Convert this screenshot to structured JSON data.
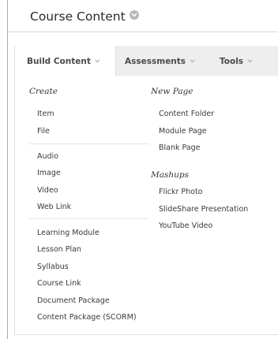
{
  "header": {
    "title": "Course Content"
  },
  "menubar": {
    "tabs": [
      {
        "label": "Build Content",
        "active": true
      },
      {
        "label": "Assessments",
        "active": false
      },
      {
        "label": "Tools",
        "active": false
      }
    ]
  },
  "dropdown": {
    "left_column": {
      "heading": "Create",
      "groups": [
        [
          "Item",
          "File"
        ],
        [
          "Audio",
          "Image",
          "Video",
          "Web Link"
        ],
        [
          "Learning Module",
          "Lesson Plan",
          "Syllabus",
          "Course Link",
          "Document Package",
          "Content Package (SCORM)"
        ]
      ]
    },
    "right_column": {
      "new_page_heading": "New Page",
      "new_page_items": [
        "Content Folder",
        "Module Page",
        "Blank Page"
      ],
      "mashups_heading": "Mashups",
      "mashups_items": [
        "Flickr Photo",
        "SlideShare Presentation",
        "YouTube Video"
      ]
    }
  },
  "icons": {
    "title_chevron": "chevron-down-circle-icon",
    "tab_chevron": "chevron-down-icon"
  },
  "colors": {
    "menubar_bg": "#eeeeee",
    "text": "#3a3a3a",
    "chevron_circle": "#b8b8b8"
  }
}
